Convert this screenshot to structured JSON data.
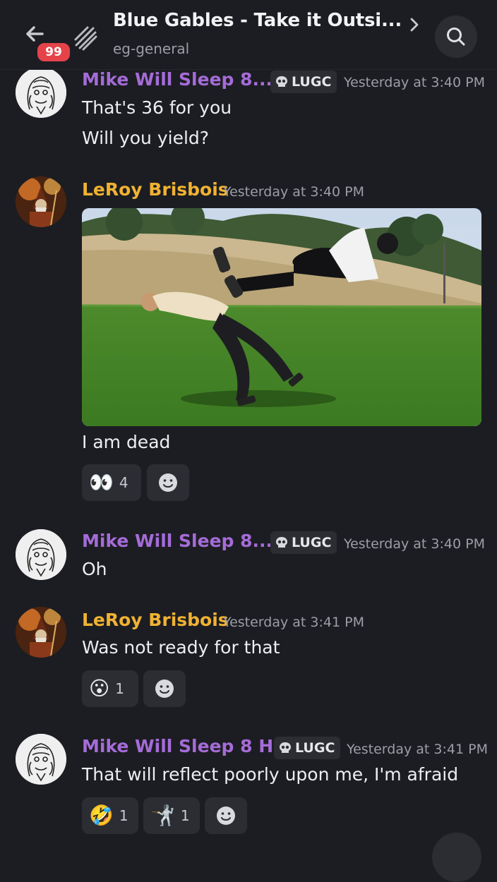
{
  "header": {
    "unread_count": "99",
    "title": "Blue Gables - Take it Outsi...",
    "channel": "eg-general"
  },
  "messages": [
    {
      "author": "Mike Will Sleep 8...",
      "tag": "LUGC",
      "time": "Yesterday at 3:40 PM",
      "lines": [
        "That's 36 for you",
        "Will you yield?"
      ]
    },
    {
      "author": "LeRoy Brisbois",
      "time": "Yesterday at 3:40 PM",
      "text": "I am dead",
      "reactions": [
        {
          "emoji": "👀",
          "count": "4"
        }
      ]
    },
    {
      "author": "Mike Will Sleep 8...",
      "tag": "LUGC",
      "time": "Yesterday at 3:40 PM",
      "text": "Oh"
    },
    {
      "author": "LeRoy Brisbois",
      "time": "Yesterday at 3:41 PM",
      "text": "Was not ready for that",
      "reactions": [
        {
          "emoji": "😮",
          "count": "1"
        }
      ]
    },
    {
      "author": "Mike Will Sleep 8 H...",
      "tag": "LUGC",
      "time": "Yesterday at 3:41 PM",
      "text": "That will reflect poorly upon me, I'm afraid",
      "reactions": [
        {
          "emoji": "🤣",
          "count": "1"
        },
        {
          "emoji": "🤺",
          "count": "1"
        }
      ]
    }
  ],
  "colors": {
    "background": "#1c1d22",
    "mike_name": "#a56cd8",
    "leroy_name": "#f0b232",
    "badge": "#e5434a"
  }
}
